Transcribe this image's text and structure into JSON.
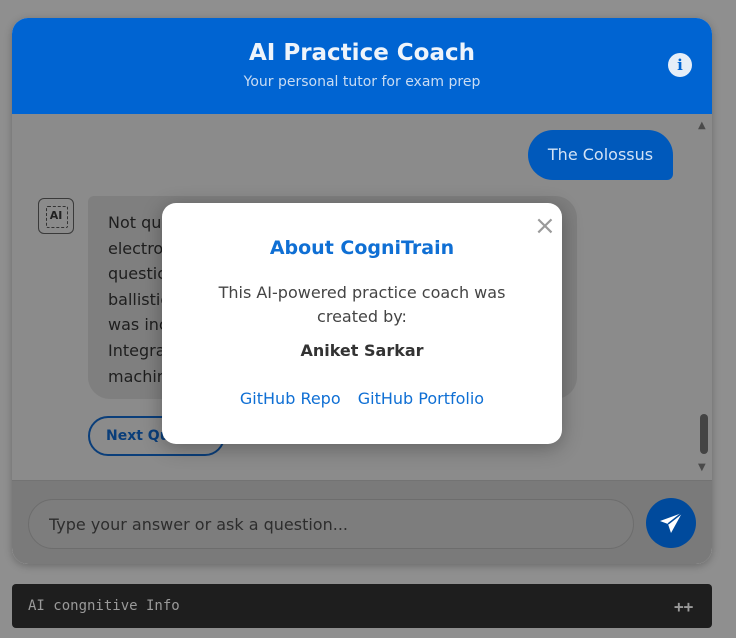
{
  "header": {
    "title": "AI Practice Coach",
    "subtitle": "Your personal tutor for exam prep",
    "info_icon": "i"
  },
  "chat": {
    "user_message": "The Colossus",
    "bot_avatar_label": "AI",
    "bot_message_lines": [
      "Not qu",
      "electro",
      "questic",
      "ballistic",
      "was inc",
      "Integra",
      "machin"
    ],
    "next_question_label": "Next Question"
  },
  "input": {
    "placeholder": "Type your answer or ask a question...",
    "send_icon": "paper-plane-icon"
  },
  "footer": {
    "title": "AI congnitive Info",
    "expand_label": "++"
  },
  "modal": {
    "title": "About CogniTrain",
    "description": "This AI-powered practice coach was created by:",
    "author": "Aniket Sarkar",
    "links": [
      "GitHub Repo",
      "GitHub Portfolio"
    ],
    "close_symbol": "×"
  },
  "colors": {
    "primary": "#0064d2",
    "link": "#0f6fd4",
    "footer_bg": "#1e1e1e"
  }
}
